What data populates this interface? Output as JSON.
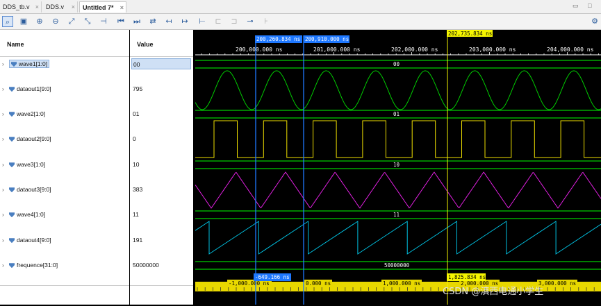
{
  "tabs": [
    {
      "label": "DDS_tb.v"
    },
    {
      "label": "DDS.v"
    },
    {
      "label": "Untitled 7*"
    }
  ],
  "columns": {
    "name": "Name",
    "value": "Value"
  },
  "signals": [
    {
      "name": "wave1[1:0]",
      "value": "00"
    },
    {
      "name": "dataout1[9:0]",
      "value": "795"
    },
    {
      "name": "wave2[1:0]",
      "value": "01"
    },
    {
      "name": "dataout2[9:0]",
      "value": "0"
    },
    {
      "name": "wave3[1:0]",
      "value": "10"
    },
    {
      "name": "dataout3[9:0]",
      "value": "383"
    },
    {
      "name": "wave4[1:0]",
      "value": "11"
    },
    {
      "name": "dataout4[9:0]",
      "value": "191"
    },
    {
      "name": "frequence[31:0]",
      "value": "50000000"
    }
  ],
  "time_ruler": {
    "ticks": [
      "200,000.000 ns",
      "201,000.000 ns",
      "202,000.000 ns",
      "203,000.000 ns",
      "204,000.000 ns"
    ],
    "cursor1": "200,260.834 ns",
    "cursor2": "200,910.000 ns",
    "marker": "202,735.834 ns"
  },
  "bus_values": [
    "00",
    "01",
    "10",
    "11",
    "50000000"
  ],
  "bottom_ruler": {
    "ticks": [
      "-1,000.000 ns",
      "0.000 ns",
      "1,000.000 ns",
      "2,000.000 ns",
      "3,000.000 ns"
    ],
    "delta1": "-649.166 ns",
    "delta2": "1,825.834 ns"
  },
  "watermark": "CSDN @滇西电通小学生",
  "colors": {
    "background": "#000000",
    "bus": "#00ff00",
    "sine": "#00cc00",
    "square": "#f0e000",
    "triangle": "#e020e0",
    "saw": "#00c0e0",
    "cursor": "#1e78ff",
    "marker": "#f5f500"
  }
}
